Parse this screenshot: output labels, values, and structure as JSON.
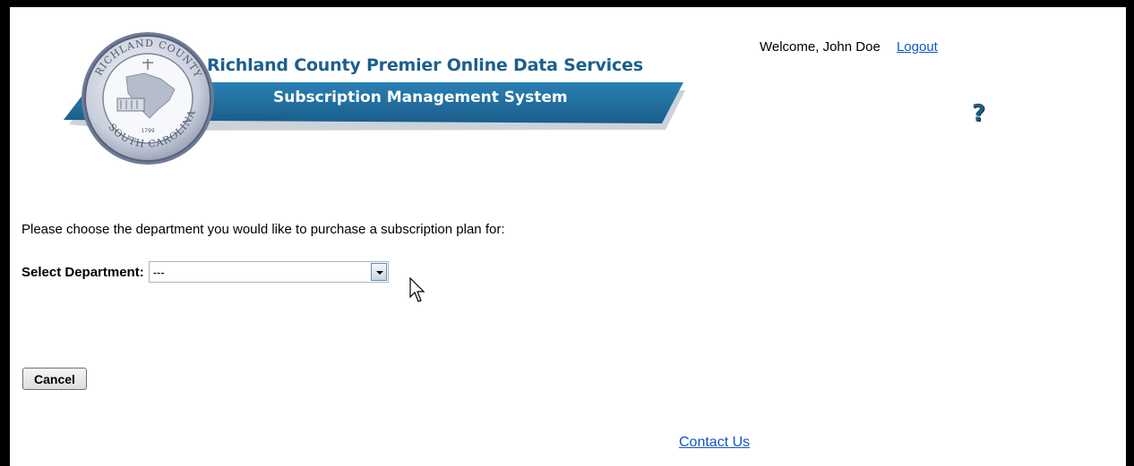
{
  "header": {
    "title": "Richland County Premier Online Data Services",
    "subtitle": "Subscription Management System",
    "seal_text_top": "RICHLAND COUNTY",
    "seal_text_bottom": "SOUTH CAROLINA",
    "seal_year": "1799"
  },
  "user": {
    "welcome": "Welcome, John Doe",
    "logout_label": "Logout"
  },
  "help": {
    "icon": "question-mark-icon",
    "label": "?"
  },
  "main": {
    "instruction": "Please choose the department you would like to purchase a subscription plan for:",
    "department_label": "Select Department:",
    "department_value": "---"
  },
  "actions": {
    "cancel_label": "Cancel"
  },
  "footer": {
    "contact_label": "Contact Us"
  },
  "colors": {
    "brand_blue": "#1c5f8f",
    "banner_blue": "#1f6e9f",
    "link": "#1155cc"
  }
}
